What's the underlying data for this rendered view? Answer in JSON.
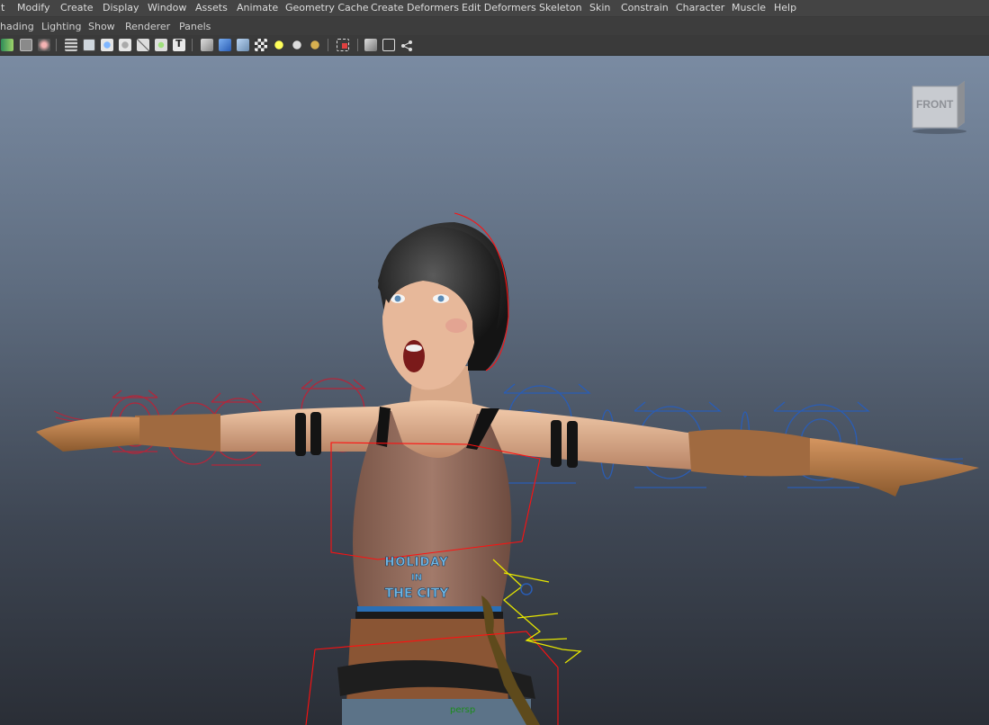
{
  "menus": [
    "t",
    "Modify",
    "Create",
    "Display",
    "Window",
    "Assets",
    "Animate",
    "Geometry Cache",
    "Create Deformers",
    "Edit Deformers",
    "Skeleton",
    "Skin",
    "Constrain",
    "Character",
    "Muscle",
    "Help"
  ],
  "panel_menus": [
    "hading",
    "Lighting",
    "Show",
    "Renderer",
    "Panels"
  ],
  "toolbar_icons": [
    "film-gate-icon",
    "camera-attributes-icon",
    "bookmark-icon",
    "snapshot-icon",
    "isolate-select-icon",
    "grid-icon",
    "smooth-shade-icon",
    "wireframe-on-shaded-icon",
    "xray-icon",
    "xray-joints-icon",
    "textured-icon",
    "default-material-icon",
    "flat-shade-icon",
    "shaded-cube-icon",
    "bounding-box-icon",
    "checker-icon",
    "default-light-icon",
    "all-lights-icon",
    "shadows-icon",
    "select-camera-icon",
    "resolution-gate-icon",
    "safe-frame-icon",
    "hud-icon"
  ],
  "viewcube_label": "FRONT",
  "camera_label": "persp",
  "shirt_text": {
    "line1": "HOLIDAY",
    "line2": "IN",
    "line3": "THE CITY"
  },
  "colors": {
    "menubar": "#444444",
    "viewport_top": "#7a8ba2",
    "viewport_bottom": "#2a2e36",
    "left_control": "#b4263a",
    "right_control": "#2a5db5",
    "selected_control": "#e6e600",
    "bounding": "#ff1010"
  }
}
